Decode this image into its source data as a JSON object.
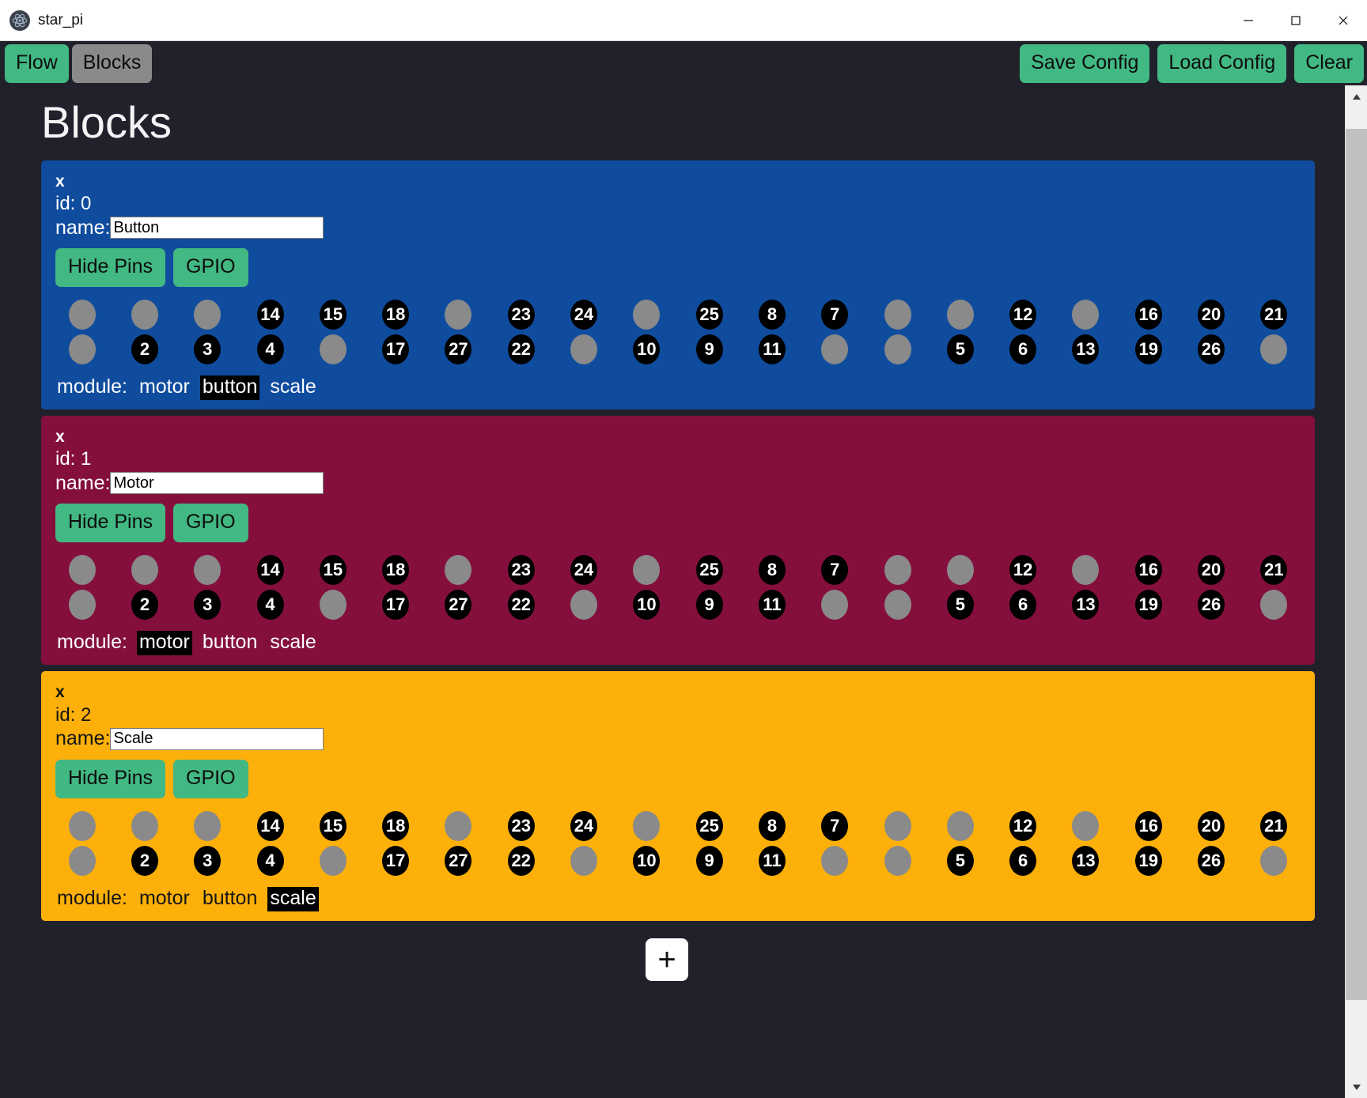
{
  "window": {
    "title": "star_pi",
    "icon": "electron-app-icon",
    "controls": {
      "minimize": "minimize-icon",
      "maximize": "maximize-icon",
      "close": "close-icon"
    }
  },
  "toolbar": {
    "left": [
      {
        "label": "Flow",
        "active": false,
        "style": "green"
      },
      {
        "label": "Blocks",
        "active": true,
        "style": "grey"
      }
    ],
    "right": [
      {
        "label": "Save Config"
      },
      {
        "label": "Load Config"
      },
      {
        "label": "Clear"
      }
    ]
  },
  "page": {
    "title": "Blocks",
    "add_button_label": "+",
    "background": "#21212b"
  },
  "labels": {
    "close_block": "x",
    "id_prefix": "id: ",
    "name_label": "name:",
    "hide_pins": "Hide Pins",
    "gpio": "GPIO",
    "module_label": "module:"
  },
  "module_options": [
    "motor",
    "button",
    "scale"
  ],
  "pin_rows": [
    [
      "",
      "",
      "",
      "14",
      "15",
      "18",
      "",
      "23",
      "24",
      "",
      "25",
      "8",
      "7",
      "",
      "",
      "12",
      "",
      "16",
      "20",
      "21"
    ],
    [
      "",
      "2",
      "3",
      "4",
      "",
      "17",
      "27",
      "22",
      "",
      "10",
      "9",
      "11",
      "",
      "",
      "5",
      "6",
      "13",
      "19",
      "26",
      ""
    ]
  ],
  "blocks": [
    {
      "id": "0",
      "id_text": "id: 0",
      "name": "Button",
      "color": "#0f4c9e",
      "text_theme": "light",
      "selected_module": "button"
    },
    {
      "id": "1",
      "id_text": "id: 1",
      "name": "Motor",
      "color": "#840f3c",
      "text_theme": "light",
      "selected_module": "motor"
    },
    {
      "id": "2",
      "id_text": "id: 2",
      "name": "Scale",
      "color": "#fdb009",
      "text_theme": "dark",
      "selected_module": "scale"
    }
  ],
  "scrollbar": {
    "up_arrow": "chevron-up-icon",
    "down_arrow": "chevron-down-icon",
    "thumb": "scroll-thumb"
  }
}
